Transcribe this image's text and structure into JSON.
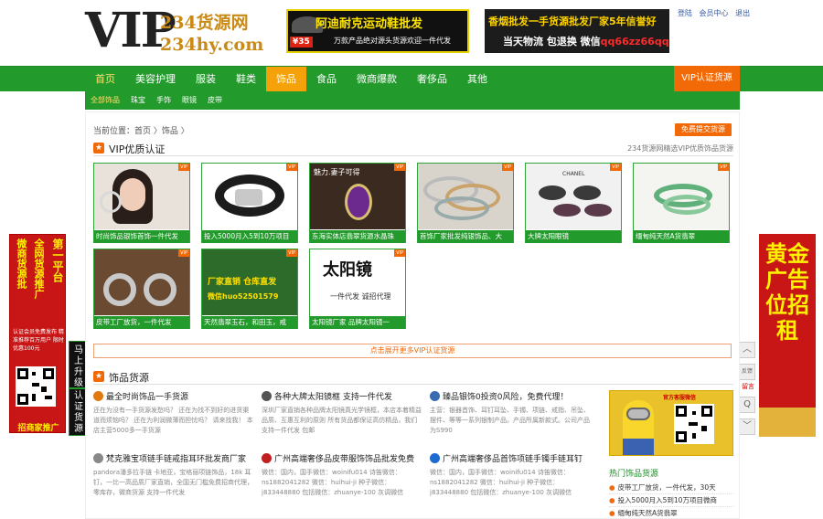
{
  "header": {
    "logo_vip": "VIP",
    "logo_line1": "234货源网",
    "logo_line2": "234hy.com",
    "ad1_line1": "阿迪耐克运动鞋批发",
    "ad1_line2": "万款产品绝对源头货源欢迎一件代发",
    "ad1_price": "¥35",
    "ad2_line1": "香烟批发一手货源批发厂家5年信誉好",
    "ad2_line2_prefix": "当天物流 包退换 微信",
    "ad2_line2_wechat": "qq66zz66qq",
    "links": [
      "登陆",
      "会员中心",
      "退出"
    ]
  },
  "nav": {
    "items": [
      "首页",
      "美容护理",
      "服装",
      "鞋类",
      "饰品",
      "食品",
      "微商爆款",
      "奢侈品",
      "其他"
    ],
    "active_index": 4,
    "vip_button": "VIP认证货源",
    "sub_items": [
      "全部饰品",
      "珠宝",
      "手饰",
      "眼镜",
      "皮带"
    ],
    "sub_active_index": 0
  },
  "left_ad": {
    "col1": "微商货源批",
    "col2": "全网货源推广",
    "col3": "第一平台",
    "small": "认证会员免费发布 精准推荐百万用户 限时优惠100元",
    "bottom": "招商家推广"
  },
  "upgrade": {
    "top": "马上升级",
    "bottom": "认证货源"
  },
  "right_ad": {
    "text": "黄金广告位招租"
  },
  "side_tools": {
    "up": "︿",
    "feedback": "反馈",
    "feedback_label": "留言",
    "qq": "Q",
    "down": "﹀"
  },
  "main": {
    "breadcrumb": "当前位置：首页 〉饰品 〉",
    "free_button": "免费提交货源",
    "vip_section_title": "VIP优质认证",
    "vip_section_right": "234货源网精选VIP优质饰品货源",
    "more_button": "点击展开更多VIP认证货源",
    "goods_section_title": "饰品货源"
  },
  "cards": [
    {
      "caption": "时尚饰品银饰首饰一件代发",
      "tag": "VIP"
    },
    {
      "caption": "投入5000月入5到10万项目",
      "tag": "VIP"
    },
    {
      "caption": "东海实体店翡翠货源水晶珠",
      "tag": "VIP"
    },
    {
      "caption": "首饰厂家批发纯银饰品、大",
      "tag": "VIP"
    },
    {
      "caption": "大牌太阳眼镜",
      "tag": "VIP"
    },
    {
      "caption": "缅甸纯天然A货翡翠",
      "tag": "VIP"
    },
    {
      "caption": "皮带工厂放货，一件代发",
      "tag": "VIP"
    },
    {
      "caption": "天然翡翠玉石，和田玉，戒",
      "tag": "VIP",
      "overlay_top": "厂家直销 仓库直发",
      "overlay_bottom": "微信huo52501579"
    },
    {
      "caption": "太阳镜厂家 品牌太阳镜一",
      "tag": "VIP",
      "overlay_top": "太阳镜",
      "overlay_bottom": "一件代发 诚招代理"
    }
  ],
  "news": [
    {
      "title": "最全时尚饰品一手货源",
      "body": "还在为没有一手货源发愁吗？ 还在为找不到好的进货渠道而烦恼吗？ 还在为利润微薄而担忧吗？ 请来找我！ 本店主营5000多一手货源"
    },
    {
      "title": "各种大牌太阳镜框 支持一件代发",
      "body": "深圳厂家直销各种品牌太阳镜真光学镜框，本店本着精益品质、互惠互利的原则 所有货品都保证高仿精品，我们支持一件代发 包邮"
    },
    {
      "title": "臻品银饰0投资0风险，免费代理！",
      "body": "主营：银器首饰、耳钉耳坠、手镯、项链、戒指、吊坠、摆件、等等一系列银制产品。产品所属新款式。公司产品为S990"
    },
    {
      "title": "梵克雅宝项链手链戒指耳环批发商厂家",
      "body": "pandora潘多拉手链 卡地亚，宝格丽项链饰品，18k 耳钉，一比一高品质厂家直销，全国无门槛免费招商代理，零库存，微商货源 支持一件代发"
    },
    {
      "title": "广州高端奢侈品皮带服饰饰品批发免费",
      "body": "微信：国内，国手微信：woinifu014 诗笛微信：ns1882041282 微信：huihui-ji 种子微信：j833448880 包括微信：zhuanye-100 灰调微信"
    },
    {
      "title": "广州高端奢侈品首饰项链手镯手链耳钉",
      "body": "微信：国内，国手微信：woinifu014 诗笛微信：ns1882041282 微信：huihui-ji 种子微信：j833448880 包括微信：zhuanye-100 灰调微信"
    }
  ],
  "hot": {
    "promo_label": "官方客服微信",
    "title": "热门饰品货源",
    "items": [
      "皮带工厂放货，一件代发，30天",
      "投入5000月入5到10万项目微商",
      "缅甸纯天然A货翡翠"
    ]
  }
}
